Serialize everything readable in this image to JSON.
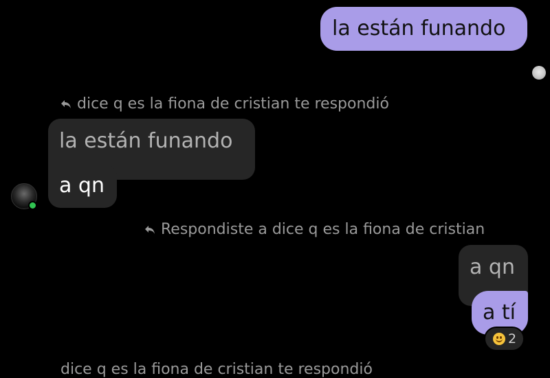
{
  "messages": {
    "top_outgoing": "la están funando",
    "incoming_reply_header": "dice q es la fiona de cristian te respondió",
    "incoming_quoted": "la están funando",
    "incoming_message": "a qn",
    "outgoing_reply_header": "Respondiste a dice q es la fiona de cristian",
    "outgoing_quoted": "a qn",
    "outgoing_message": "a tí",
    "reaction_count": "2",
    "bottom_cut_header": "dice q es la fiona de cristian te respondió"
  },
  "icons": {
    "reply_arrow": "reply-arrow-icon",
    "reaction_emoji": "grinning-face-emoji"
  },
  "colors": {
    "background": "#000000",
    "outgoing_bubble": "#a99ce8",
    "incoming_bubble": "#262626",
    "online_indicator": "#31c452"
  }
}
